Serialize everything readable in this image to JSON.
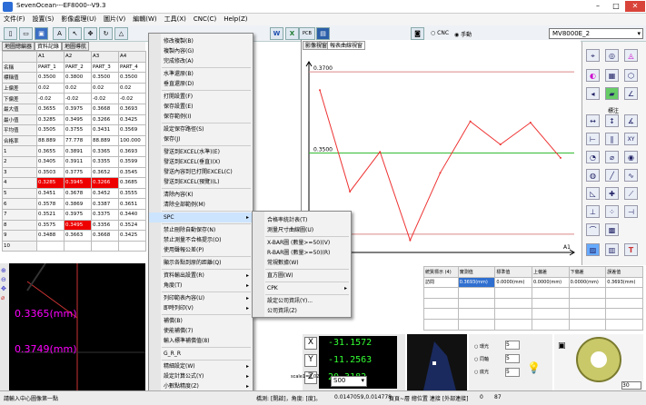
{
  "app": {
    "title": "SevenOcean---EF8000--V9.3"
  },
  "menubar": [
    "文件(F)",
    "設置(S)",
    "影像處理(U)",
    "圖片(V)",
    "編輯(W)",
    "工具(X)",
    "CNC(C)",
    "Help(Z)"
  ],
  "toolbar": {
    "mode_cnc": "CNC",
    "mode_manual": "手動",
    "device": "MV8000E_2",
    "pcb": "PCB"
  },
  "left_tabs": [
    "地圖總編器",
    "資料記錄",
    "地圖導航"
  ],
  "table": {
    "cols": [
      "",
      "A1",
      "A2",
      "A3",
      "A4",
      "A10"
    ],
    "rows": [
      [
        "名稱",
        "PART_1",
        "PART_2",
        "PART_3",
        "PART_4"
      ],
      [
        "標稱值",
        "0.3500",
        "0.3800",
        "0.3500",
        "0.3500"
      ],
      [
        "上偏差",
        "0.02",
        "0.02",
        "0.02",
        "0.02"
      ],
      [
        "下偏差",
        "-0.02",
        "-0.02",
        "-0.02",
        "-0.02"
      ],
      [
        "最大值",
        "0.3655",
        "0.3975",
        "0.3668",
        "0.3693"
      ],
      [
        "最小值",
        "0.3285",
        "0.3495",
        "0.3266",
        "0.3425"
      ],
      [
        "平均值",
        "0.3505",
        "0.3755",
        "0.3431",
        "0.3569"
      ],
      [
        "合格率",
        "88.889",
        "77.778",
        "88.889",
        "100.000"
      ],
      [
        "1",
        "0.3655",
        "0.3891",
        "0.3365",
        "0.3693"
      ],
      [
        "2",
        "0.3405",
        "0.3911",
        "0.3355",
        "0.3599"
      ],
      [
        "3",
        "0.3503",
        "0.3775",
        "0.3652",
        "0.3545"
      ],
      [
        "4",
        "0.3285",
        "0.3945",
        "0.3266",
        "0.3685"
      ],
      [
        "5",
        "0.3451",
        "0.3678",
        "0.3452",
        "0.3555"
      ],
      [
        "6",
        "0.3578",
        "0.3869",
        "0.3387",
        "0.3651"
      ],
      [
        "7",
        "0.3521",
        "0.3975",
        "0.3375",
        "0.3440"
      ],
      [
        "8",
        "0.3575",
        "0.3495",
        "0.3356",
        "0.3524"
      ],
      [
        "9",
        "0.3488",
        "0.3663",
        "0.3668",
        "0.3425"
      ],
      [
        "10",
        "",
        "",
        "",
        ""
      ]
    ]
  },
  "context_menu": {
    "items": [
      "修改複製(B)",
      "複製內容(G)",
      "完成修改(A)",
      "-",
      "水準還原(B)",
      "垂直還原(D)",
      "-",
      "打開設置(F)",
      "保存設置(E)",
      "保存範例(I)",
      "-",
      "設定保存路徑(S)",
      "保存(J)",
      "-",
      "發送到EXCEL(水準)(E)",
      "發送到EXCEL(垂直)(X)",
      "發送內容到已打開EXCEL(C)",
      "發送到EXCEL(預覽)(L)",
      "-",
      "清除內容(K)",
      "清除全部範例(M)",
      "-",
      "SPC",
      "-",
      "禁止刪除自動保存(N)",
      "禁止測量不合格提示(O)",
      "使用聲報公差(P)",
      "-",
      "顯示各點到原的距離(Q)",
      "-",
      "資料輸出設置(R)",
      "角度(T)",
      "-",
      "列印範表內容(U)",
      "即時列印(V)",
      "-",
      "補償(B)",
      "使能補償(7)",
      "輸入標準補償值(8)",
      "-",
      "G_R_R",
      "-",
      "精細設定(W)",
      "設定計算公式(Y)",
      "小數點精度(Z)"
    ],
    "submenu_items": [
      "合格率統計表(T)",
      "測量尺寸曲線圖(U)",
      "-",
      "X-BAR圖 (數量>=50)(V)",
      "R-BAR圖 (數量>=50)(R)",
      "常規數據(W)",
      "-",
      "直方圖(W)",
      "-",
      "CPK",
      "-",
      "設定公司資訊(Y)...",
      "公司資訊(Z)"
    ]
  },
  "chart_tabs": [
    "影像視窗",
    "報表曲線視窗"
  ],
  "chart_data": {
    "type": "line",
    "x": [
      1,
      2,
      3,
      4,
      5,
      6,
      7,
      8,
      9
    ],
    "series": [
      {
        "values": [
          0.3655,
          0.3405,
          0.3503,
          0.3285,
          0.3451,
          0.3578,
          0.3521,
          0.3575,
          0.3488
        ]
      }
    ],
    "ref_lines": {
      "upper": 0.37,
      "nominal": 0.35,
      "lower": 0.33
    },
    "ref_labels": [
      "0.3700",
      "0.3500"
    ],
    "xlabel": "A1",
    "ylim": [
      0.3255,
      0.3725
    ],
    "colors": {
      "line": "#e33",
      "upper": "#d88",
      "nominal": "#3b3",
      "lower": "#d88"
    }
  },
  "stats_table": {
    "headers": [
      "統質標示 (4)",
      "實測值",
      "標準值",
      "上偏差",
      "下偏差",
      "誤差值"
    ],
    "row": [
      "訪問",
      "0.3693(mm)",
      "0.0000(mm)",
      "0.0000(mm)",
      "0.0000(mm)",
      "0.3693(mm)"
    ]
  },
  "image_panel": {
    "label1": "0.3365(mm)",
    "label2": "0.3749(mm)"
  },
  "dro": {
    "x": "-31.1572",
    "y": "-11.2563",
    "z": "20.3182",
    "x_label": "X",
    "y_label": "Y",
    "z_label": "Z",
    "scale": "scale1=0.0241",
    "mode": "S00"
  },
  "lighting": {
    "r1": "環光",
    "r2": "同軸",
    "r3": "底光",
    "v1": "5",
    "v2": "5",
    "v3": "5"
  },
  "status": {
    "left": "請輸入中心圖像第一點",
    "mid": "橋測: [開啟]，角度: [度]。",
    "coords": "0.0147059,0.014778",
    "right": "頁頁~層 總位置  連接 [外部連接]",
    "n1": "0",
    "n2": "87"
  },
  "right_panel": {
    "zoom": "30",
    "label_standard": "標注"
  }
}
